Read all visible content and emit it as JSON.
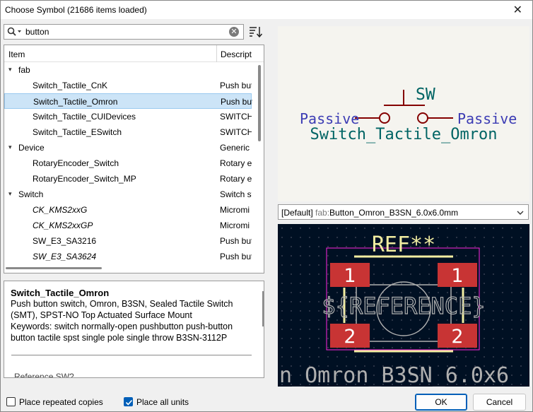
{
  "window": {
    "title": "Choose Symbol (21686 items loaded)"
  },
  "search": {
    "value": "button"
  },
  "tree": {
    "col_item": "Item",
    "col_desc": "Descript",
    "rows": [
      {
        "kind": "group",
        "expanded": true,
        "name": "fab",
        "desc": ""
      },
      {
        "kind": "child",
        "name": "Switch_Tactile_CnK",
        "desc": "Push but",
        "italic": false,
        "selected": false
      },
      {
        "kind": "child",
        "name": "Switch_Tactile_Omron",
        "desc": "Push but",
        "italic": false,
        "selected": true
      },
      {
        "kind": "child",
        "name": "Switch_Tactile_CUIDevices",
        "desc": "SWITCH",
        "italic": false,
        "selected": false
      },
      {
        "kind": "child",
        "name": "Switch_Tactile_ESwitch",
        "desc": "SWITCH",
        "italic": false,
        "selected": false
      },
      {
        "kind": "group",
        "expanded": true,
        "name": "Device",
        "desc": "Generic s"
      },
      {
        "kind": "child",
        "name": "RotaryEncoder_Switch",
        "desc": "Rotary er",
        "italic": false,
        "selected": false
      },
      {
        "kind": "child",
        "name": "RotaryEncoder_Switch_MP",
        "desc": "Rotary er",
        "italic": false,
        "selected": false
      },
      {
        "kind": "group",
        "expanded": true,
        "name": "Switch",
        "desc": "Switch sy"
      },
      {
        "kind": "child",
        "name": "CK_KMS2xxG",
        "desc": "Micromi",
        "italic": true,
        "selected": false
      },
      {
        "kind": "child",
        "name": "CK_KMS2xxGP",
        "desc": "Micromi",
        "italic": true,
        "selected": false
      },
      {
        "kind": "child",
        "name": "SW_E3_SA3216",
        "desc": "Push but",
        "italic": false,
        "selected": false
      },
      {
        "kind": "child",
        "name": "SW_E3_SA3624",
        "desc": "Push but",
        "italic": true,
        "selected": false
      }
    ]
  },
  "details": {
    "name": "Switch_Tactile_Omron",
    "description": "Push button switch, Omron, B3SN, Sealed Tactile Switch (SMT), SPST-NO Top Actuated Surface Mount",
    "keywords": "Keywords: switch normally-open pushbutton push-button button tactile spst single pole single throw B3SN-3112P",
    "reference_partial": "Reference  SW?"
  },
  "symbol_preview": {
    "ref": "SW",
    "value": "Switch_Tactile_Omron",
    "pin_left": "Passive",
    "pin_right": "Passive",
    "colors": {
      "body": "#840000",
      "pin_text": "#3c3cb4",
      "ref_text": "#006464"
    }
  },
  "footprint_selector": {
    "prefix": "[Default] ",
    "lib": "fab:",
    "name": "Button_Omron_B3SN_6.0x6.0mm"
  },
  "footprint_preview": {
    "ref": "REF**",
    "reference_field": "${REFERENCE}",
    "value_partial": "n_Omron_B3SN_6.0x6",
    "pads": [
      "1",
      "1",
      "2",
      "2"
    ],
    "colors": {
      "bg": "#001023",
      "pad": "#c83434",
      "silk": "#f2eda1",
      "courtyard": "#ff26e2",
      "fab": "#afafaf"
    }
  },
  "footer": {
    "place_repeated": "Place repeated copies",
    "place_repeated_checked": false,
    "place_all_units": "Place all units",
    "place_all_units_checked": true,
    "ok": "OK",
    "cancel": "Cancel"
  }
}
